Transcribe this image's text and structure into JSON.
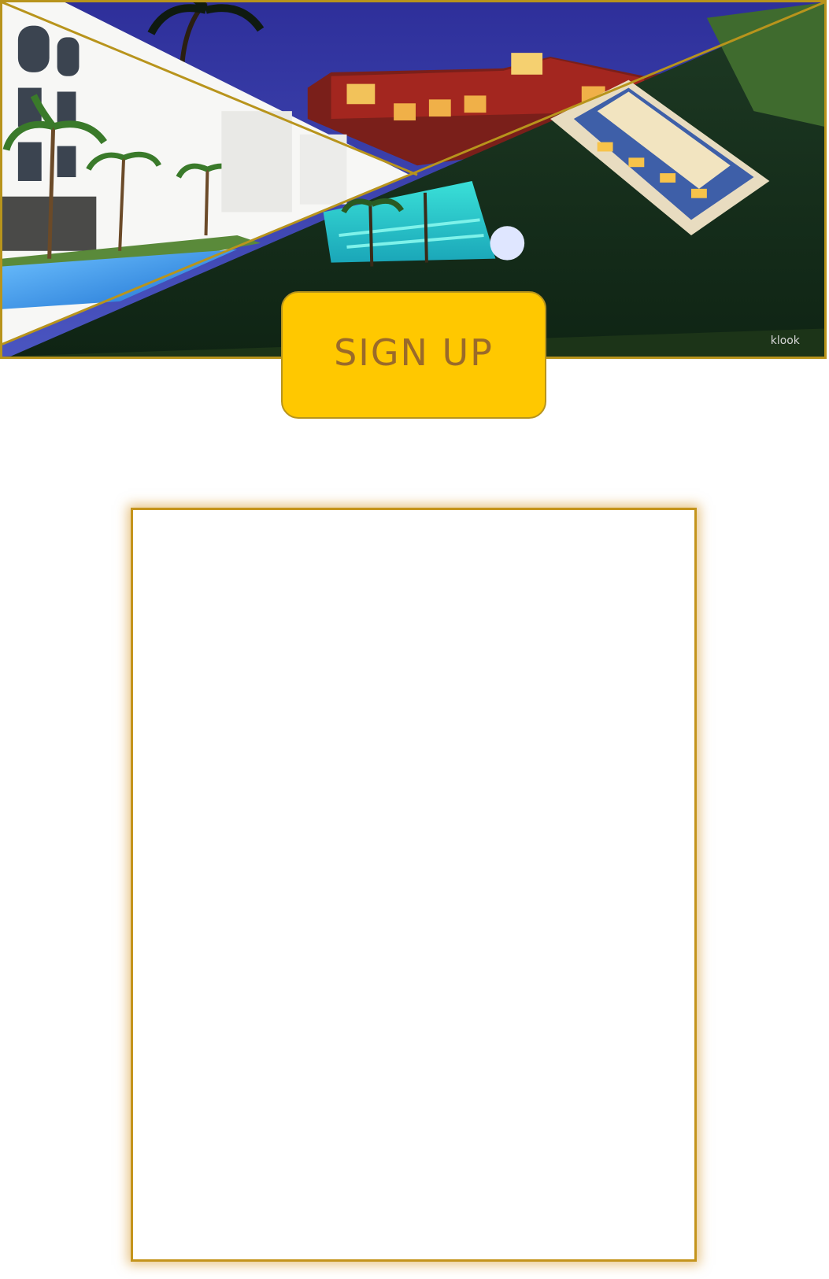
{
  "hero": {
    "photos": [
      "hotel-white-facade-pool",
      "hotel-night-red-building",
      "resort-aerial-pool-night"
    ],
    "watermark": "klook",
    "border_color": "#b8941c"
  },
  "signup": {
    "label": "SIGN UP",
    "background": "#ffc800",
    "text_color": "#9a6a2a"
  },
  "card": {
    "border_color": "#c4941c"
  }
}
